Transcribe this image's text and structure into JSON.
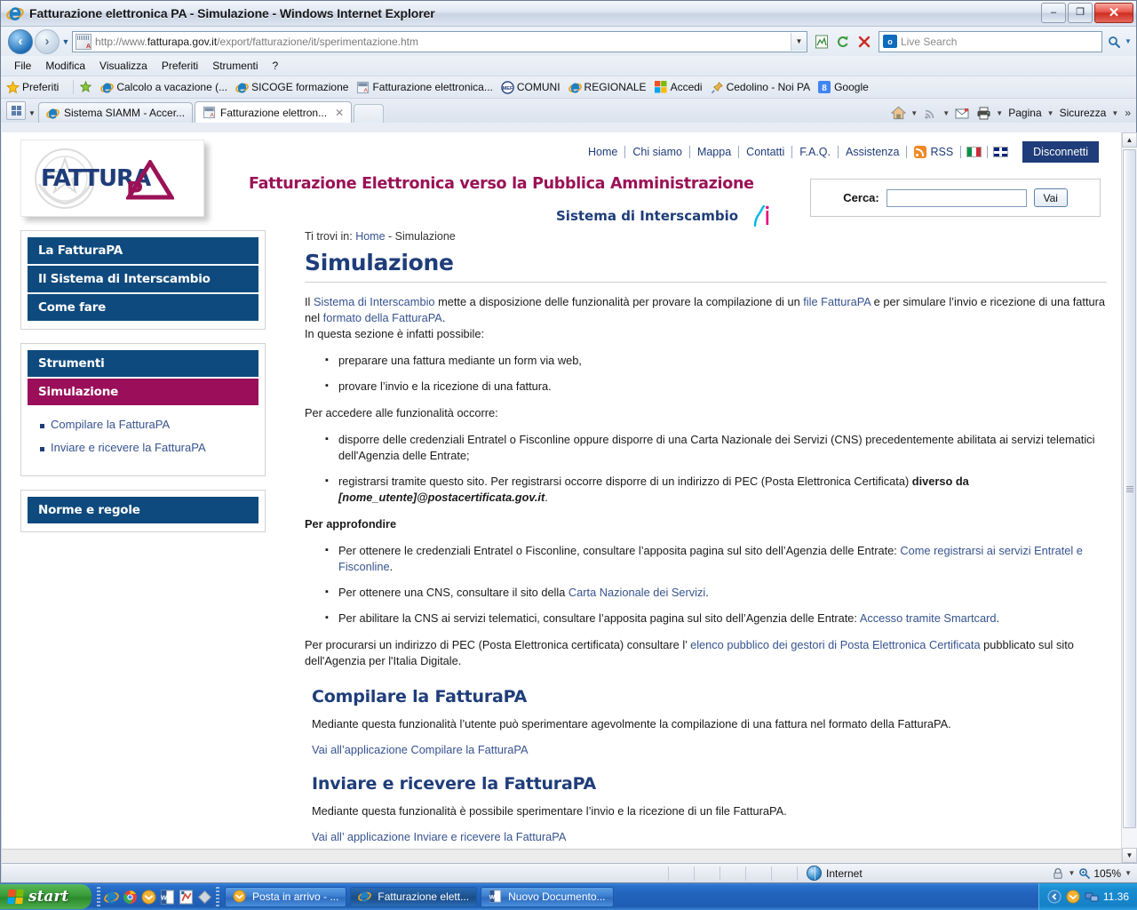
{
  "window": {
    "title": "Fatturazione elettronica PA - Simulazione - Windows Internet Explorer",
    "minimize_label": "–",
    "restore_label": "❐",
    "close_label": "✕"
  },
  "browser": {
    "address": {
      "scheme": "http://www.",
      "domain": "fatturapa.gov.it",
      "path": "/export/fatturazione/it/sperimentazione.htm",
      "full": "http://www.fatturapa.gov.it/export/fatturazione/it/sperimentazione.htm"
    },
    "search": {
      "placeholder": "Live Search",
      "value": ""
    },
    "menu": [
      "File",
      "Modifica",
      "Visualizza",
      "Preferiti",
      "Strumenti",
      "?"
    ],
    "favorites_label": "Preferiti",
    "favorites": [
      {
        "label": "Calcolo a vacazione (...",
        "icon": "ie-icon"
      },
      {
        "label": "SICOGE formazione",
        "icon": "ie-icon"
      },
      {
        "label": "Fatturazione elettronica...",
        "icon": "page-icon"
      },
      {
        "label": "COMUNI",
        "icon": "mef-icon"
      },
      {
        "label": "REGIONALE",
        "icon": "ie-icon"
      },
      {
        "label": "Accedi",
        "icon": "windows-icon"
      },
      {
        "label": "Cedolino - Noi PA",
        "icon": "pin-icon"
      },
      {
        "label": "Google",
        "icon": "google-icon"
      }
    ],
    "tabs": [
      {
        "label": "Sistema SIAMM - Accer...",
        "active": false
      },
      {
        "label": "Fatturazione elettron...",
        "active": true,
        "close_label": "✕"
      }
    ],
    "command_bar": [
      "Pagina",
      "Sicurezza"
    ],
    "command_overflow": "»"
  },
  "site": {
    "logo_alt": "FatturaPA",
    "logo_text_main": "FATTURA",
    "logo_text_p": "P",
    "topnav": [
      "Home",
      "Chi siamo",
      "Mappa",
      "Contatti",
      "F.A.Q.",
      "Assistenza"
    ],
    "rss_label": "RSS",
    "flag_it": "Italiano",
    "flag_en": "English",
    "logout_label": "Disconnetti",
    "title": "Fatturazione Elettronica verso la Pubblica Amministrazione",
    "subtitle": "Sistema di Interscambio",
    "search_label": "Cerca:",
    "search_value": "",
    "search_button": "Vai"
  },
  "sidebar": {
    "group1": [
      {
        "label": "La FatturaPA",
        "active": false
      },
      {
        "label": "Il Sistema di Interscambio",
        "active": false
      },
      {
        "label": "Come fare",
        "active": false
      }
    ],
    "group2": [
      {
        "label": "Strumenti",
        "active": false
      },
      {
        "label": "Simulazione",
        "active": true
      }
    ],
    "sublinks": [
      {
        "label": "Compilare la FatturaPA"
      },
      {
        "label": "Inviare e ricevere la FatturaPA"
      }
    ],
    "group3": [
      {
        "label": "Norme e regole",
        "active": false
      }
    ]
  },
  "main": {
    "breadcrumb_prefix": "Ti trovi in:",
    "breadcrumb_home": "Home",
    "breadcrumb_sep": " - ",
    "breadcrumb_current": "Simulazione",
    "title": "Simulazione",
    "intro_1": "Il ",
    "intro_link_1": "Sistema di Interscambio",
    "intro_2": " mette a disposizione delle funzionalità per provare la compilazione di un ",
    "intro_link_2": "file FatturaPA",
    "intro_3": " e per simulare l’invio e ricezione di una fattura nel ",
    "intro_link_3": "formato della FatturaPA",
    "intro_4": ".",
    "intro_5": "In questa sezione è infatti possibile:",
    "list1": [
      "preparare una fattura mediante un form via web,",
      "provare l’invio e la ricezione di una fattura."
    ],
    "access_lead": "Per accedere alle funzionalità occorre:",
    "list2_item1": "disporre delle credenziali Entratel o Fisconline oppure disporre di una Carta Nazionale dei Servizi (CNS) precedentemente abilitata ai servizi telematici dell'Agenzia delle Entrate;",
    "list2_item2_a": "registrarsi tramite questo sito. Per registrarsi occorre disporre di un indirizzo di PEC (Posta Elettronica Certificata) ",
    "list2_item2_b": "diverso da ",
    "list2_item2_c": "[nome_utente]@postacertificata.gov.it",
    "list2_item2_d": ".",
    "deepen_heading": "Per approfondire",
    "list3_item1_a": "Per ottenere le credenziali Entratel o Fisconline, consultare l’apposita pagina sul sito dell’Agenzia delle Entrate: ",
    "list3_item1_link": "Come registrarsi ai servizi Entratel e Fisconline",
    "list3_item1_b": ".",
    "list3_item2_a": "Per ottenere una CNS, consultare il sito della ",
    "list3_item2_link": "Carta Nazionale dei Servizi",
    "list3_item2_b": ".",
    "list3_item3_a": "Per abilitare la CNS ai servizi telematici, consultare l’apposita pagina sul sito dell’Agenzia delle Entrate: ",
    "list3_item3_link": "Accesso tramite Smartcard",
    "list3_item3_b": ".",
    "pec_a": "Per procurarsi un indirizzo di PEC (Posta Elettronica certificata) consultare l’",
    "pec_link": " elenco pubblico dei gestori di Posta Elettronica Certificata",
    "pec_b": " pubblicato sul sito dell'Agenzia per l'Italia Digitale.",
    "section1_title": "Compilare la FatturaPA",
    "section1_body": "Mediante questa funzionalità l’utente può sperimentare agevolmente la compilazione di una fattura nel formato della FatturaPA.",
    "section1_link": "Vai all’applicazione Compilare la FatturaPA",
    "section2_title": "Inviare e ricevere la FatturaPA",
    "section2_body": "Mediante questa funzionalità è possibile sperimentare l’invio e la ricezione di un file FatturaPA.",
    "section2_link": "Vai all’ applicazione Inviare e ricevere la FatturaPA"
  },
  "statusbar": {
    "zone": "Internet",
    "zoom": "105%"
  },
  "taskbar": {
    "start_label": "start",
    "tasks": [
      {
        "label": "Posta in arrivo - ...",
        "active": false,
        "icon": "outlook-icon"
      },
      {
        "label": "Fatturazione elett...",
        "active": true,
        "icon": "ie-icon"
      },
      {
        "label": "Nuovo Documento...",
        "active": false,
        "icon": "word-icon"
      }
    ],
    "clock": "11.36"
  },
  "colors": {
    "site_blue": "#0e4a7d",
    "site_magenta": "#9b0f5a",
    "link_blue": "#36538f",
    "link_magenta": "#8b2a6e",
    "taskbar_blue": "#2264bd"
  }
}
